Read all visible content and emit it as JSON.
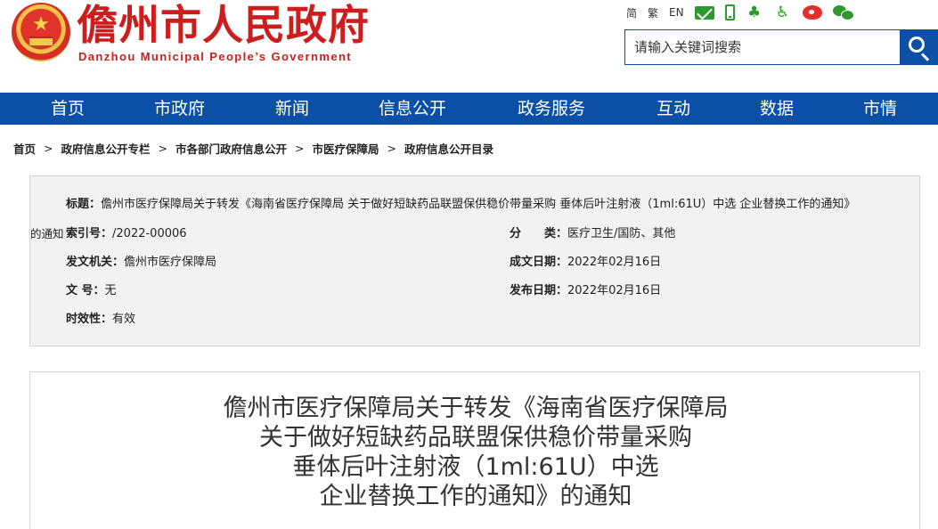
{
  "header": {
    "logo_cn": "儋州市人民政府",
    "logo_en": "Danzhou Municipal People’s Government",
    "top_links": [
      "简",
      "繁",
      "EN"
    ],
    "icons": [
      "mail-icon",
      "mobile-icon",
      "elder-mode-icon",
      "accessibility-icon",
      "weibo-icon",
      "wechat-icon"
    ],
    "search_placeholder": "请输入关键词搜索"
  },
  "nav": {
    "items": [
      "首页",
      "市政府",
      "新闻",
      "信息公开",
      "政务服务",
      "互动",
      "数据",
      "市情"
    ]
  },
  "breadcrumb": [
    "首页",
    "政府信息公开专栏",
    "市各部门政府信息公开",
    "市医疗保障局",
    "政府信息公开目录"
  ],
  "info": {
    "title_key": "标题：",
    "title_value": "儋州市医疗保障局关于转发《海南省医疗保障局 关于做好短缺药品联盟保供稳价带量采购 垂体后叶注射液（1ml:61U）中选 企业替换工作的通知》",
    "title_cont": "的通知",
    "index_key": "索引号：",
    "index_value": "/2022-00006",
    "category_key": "分　　类：",
    "category_value": "医疗卫生/国防、其他",
    "issuer_key": "发文机关：",
    "issuer_value": "儋州市医疗保障局",
    "created_key": "成文日期：",
    "created_value": "2022年02月16日",
    "docno_key": "文 号：",
    "docno_value": "无",
    "published_key": "发布日期：",
    "published_value": "2022年02月16日",
    "validity_key": "时效性：",
    "validity_value": "有效"
  },
  "article": {
    "title_lines": [
      "儋州市医疗保障局关于转发《海南省医疗保障局",
      "关于做好短缺药品联盟保供稳价带量采购",
      "垂体后叶注射液（1ml:61U）中选",
      "企业替换工作的通知》的通知"
    ]
  },
  "colors": {
    "brand_red": "#cc1e1e",
    "nav_blue": "#0b4fa6",
    "icon_green": "#2c9a2c"
  }
}
